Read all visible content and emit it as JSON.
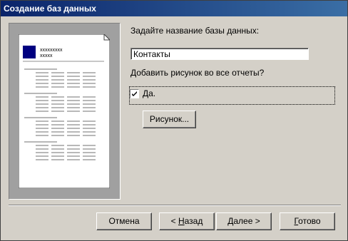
{
  "window": {
    "title": "Создание баз данных"
  },
  "preview": {
    "header_line1": "xxxxxxxxx",
    "header_line2": "xxxxx"
  },
  "form": {
    "name_prompt": "Задайте название базы данных:",
    "name_value": "Контакты",
    "picture_prompt": "Добавить рисунок во все отчеты?",
    "checkbox_label": "Да.",
    "checkbox_checked": true,
    "picture_button": "Рисунок..."
  },
  "footer": {
    "cancel": "Отмена",
    "back_prefix": "< ",
    "back_hotkey": "Н",
    "back_rest": "азад",
    "next_hotkey": "Д",
    "next_rest": "алее >",
    "finish_hotkey": "Г",
    "finish_rest": "отово"
  },
  "colors": {
    "title_start": "#0a246a",
    "title_end": "#3a6ea5",
    "logo": "#000080"
  }
}
